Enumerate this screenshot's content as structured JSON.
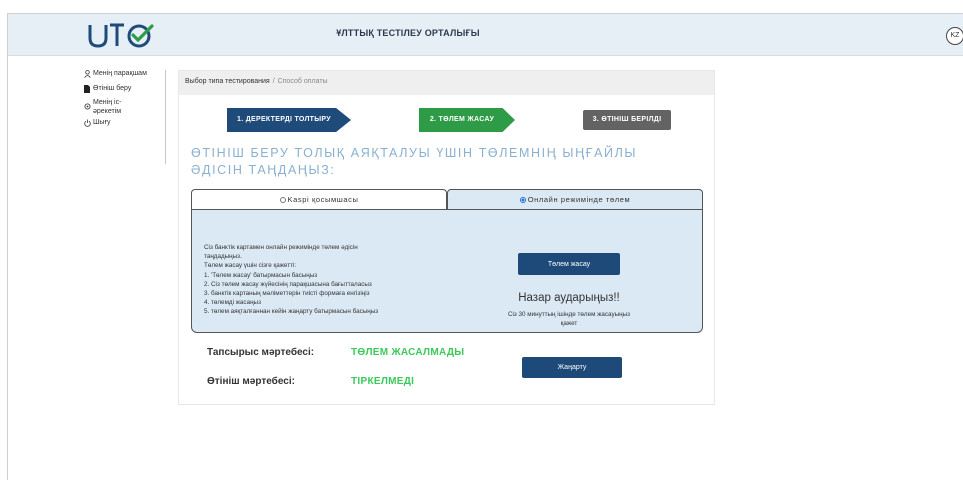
{
  "header": {
    "title": "ҰЛТТЫҚ ТЕСТІЛЕУ ОРТАЛЫҒЫ",
    "lang": "KZ",
    "brand_color": "#1f4b7a",
    "accent_color": "#2e9b47"
  },
  "sidebar": {
    "items": [
      {
        "icon": "user-icon",
        "label": "Менің парақшам"
      },
      {
        "icon": "document-icon",
        "label": "Өтініш беру"
      },
      {
        "icon": "activity-icon",
        "label": "Менің іс-әрекетім"
      },
      {
        "icon": "power-icon",
        "label": "Шығу"
      }
    ]
  },
  "breadcrumb": {
    "parent": "Выбор типа тестирования",
    "separator": "/",
    "current": "Способ оплаты"
  },
  "steps": [
    {
      "label": "1. ДЕРЕКТЕРДІ ТОЛТЫРУ",
      "color": "#1f4b7a"
    },
    {
      "label": "2. ТӨЛЕМ ЖАСАУ",
      "color": "#2e9b47"
    },
    {
      "label": "3. ӨТІНІШ БЕРІЛДІ",
      "color": "#636363"
    }
  ],
  "heading": "ӨТІНІШ БЕРУ ТОЛЫҚ АЯҚТАЛУЫ ҮШІН ТӨЛЕМНІҢ ЫҢҒАЙЛЫ ӘДІСІН ТАҢДАҢЫЗ:",
  "tabs": [
    {
      "label": "Kaspi қосымшасы",
      "selected": false
    },
    {
      "label": "Онлайн режимінде төлем",
      "selected": true
    }
  ],
  "panel": {
    "instructions": [
      "Сіз банктік картамен онлайн режимінде төлем әдісін",
      "таңдадыңыз.",
      "Төлем жасау үшін сізге қажетті:",
      "1. 'Төлем жасау' батырмасын басыңыз",
      "2. Сіз төлем жасау жүйесінің парақшасына бағытталасыз",
      "3. банктік картаның мәліметтерін тиісті формаға енгізіңіз",
      "4. төлемді жасаңыз",
      "5. төлем аяқталғаннан кейін жаңарту батырмасын басыңыз"
    ],
    "pay_button": "Төлем жасау",
    "attention_title": "Назар аударыңыз!!",
    "attention_note": "Сіз 30 минуттың ішінде төлем жасауыңыз қажет"
  },
  "status": {
    "order_label": "Тапсырыс мәртебесі:",
    "order_value": "ТӨЛЕМ ЖАСАЛМАДЫ",
    "application_label": "Өтініш мәртебесі:",
    "application_value": "ТІРКЕЛМЕДІ",
    "refresh_button": "Жаңарту"
  }
}
